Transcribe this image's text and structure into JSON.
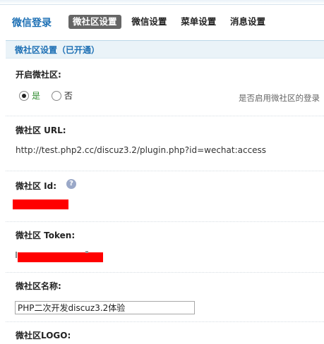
{
  "header": {
    "title": "微信登录",
    "tabs": [
      {
        "label": "微社区设置",
        "active": true
      },
      {
        "label": "微信设置",
        "active": false
      },
      {
        "label": "菜单设置",
        "active": false
      },
      {
        "label": "消息设置",
        "active": false
      }
    ]
  },
  "section": {
    "title": "微社区设置（已开通）"
  },
  "enable": {
    "label": "开启微社区:",
    "options": [
      {
        "label": "是",
        "checked": true
      },
      {
        "label": "否",
        "checked": false
      }
    ],
    "hint": "是否启用微社区的登录"
  },
  "url": {
    "label": "微社区 URL:",
    "value": "http://test.php2.cc/discuz3.2/plugin.php?id=wechat:access"
  },
  "id": {
    "label": "微社区 Id:",
    "help_icon": "question-bubble-icon",
    "value_redacted": true
  },
  "token": {
    "label": "微社区 Token:",
    "value_redacted": true
  },
  "name": {
    "label": "微社区名称:",
    "value": "PHP二次开发discuz3.2体验"
  },
  "logo": {
    "label": "微社区LOGO:"
  },
  "colors": {
    "accent": "#1c6fb4",
    "redaction": "#ff0000",
    "active_tab": "#666666"
  }
}
